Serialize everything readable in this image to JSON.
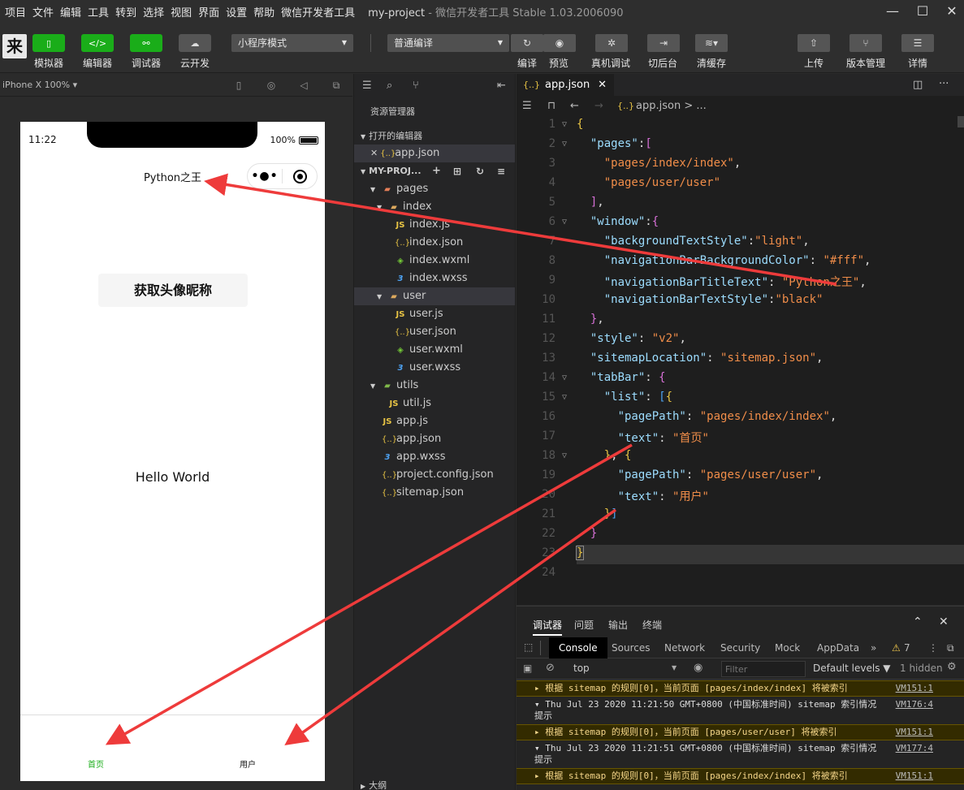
{
  "menu": {
    "items": [
      "项目",
      "文件",
      "编辑",
      "工具",
      "转到",
      "选择",
      "视图",
      "界面",
      "设置",
      "帮助",
      "微信开发者工具"
    ],
    "project_name": "my-project",
    "app_version": "- 微信开发者工具 Stable 1.03.2006090"
  },
  "toolbar": {
    "simulator": "模拟器",
    "editor": "编辑器",
    "debugger": "调试器",
    "cloud": "云开发",
    "mode_select": "小程序模式",
    "compile_select": "普通编译",
    "compile": "编译",
    "preview": "预览",
    "real_debug": "真机调试",
    "switch_bg": "切后台",
    "clear_cache": "清缓存",
    "upload": "上传",
    "version": "版本管理",
    "details": "详情"
  },
  "simulator": {
    "device": "iPhone X 100% ▾",
    "time": "11:22",
    "battery": "100%",
    "nav_title": "Python之王",
    "get_button": "获取头像昵称",
    "hello": "Hello World",
    "tab_home": "首页",
    "tab_user": "用户",
    "tab_active_color": "#1aad19"
  },
  "explorer": {
    "title": "资源管理器",
    "open_editors": "打开的编辑器",
    "open_file": "app.json",
    "project": "MY-PROJ...",
    "outline": "大纲",
    "files": [
      {
        "name": "pages",
        "icon": "folder-red"
      },
      {
        "name": "index",
        "icon": "folder"
      },
      {
        "name": "index.js",
        "icon": "js"
      },
      {
        "name": "index.json",
        "icon": "json"
      },
      {
        "name": "index.wxml",
        "icon": "wxml"
      },
      {
        "name": "index.wxss",
        "icon": "wxss"
      },
      {
        "name": "user",
        "icon": "folder"
      },
      {
        "name": "user.js",
        "icon": "js"
      },
      {
        "name": "user.json",
        "icon": "json"
      },
      {
        "name": "user.wxml",
        "icon": "wxml"
      },
      {
        "name": "user.wxss",
        "icon": "wxss"
      },
      {
        "name": "utils",
        "icon": "folder-green"
      },
      {
        "name": "util.js",
        "icon": "js"
      },
      {
        "name": "app.js",
        "icon": "js"
      },
      {
        "name": "app.json",
        "icon": "json"
      },
      {
        "name": "app.wxss",
        "icon": "wxss"
      },
      {
        "name": "project.config.json",
        "icon": "json"
      },
      {
        "name": "sitemap.json",
        "icon": "json"
      }
    ]
  },
  "editor": {
    "tab": "app.json",
    "breadcrumb": "app.json > ...",
    "line_numbers": [
      "1",
      "2",
      "3",
      "4",
      "5",
      "6",
      "7",
      "8",
      "9",
      "10",
      "11",
      "12",
      "13",
      "14",
      "15",
      "16",
      "17",
      "18",
      "19",
      "20",
      "21",
      "22",
      "23",
      "24"
    ]
  },
  "debug": {
    "tabs": [
      "调试器",
      "问题",
      "输出",
      "终端"
    ],
    "console_tabs": [
      "Console",
      "Sources",
      "Network",
      "Security",
      "Mock",
      "AppData"
    ],
    "warn_count": "7",
    "context": "top",
    "filter_placeholder": "Filter",
    "levels": "Default levels ▼",
    "hidden": "1 hidden",
    "logs": [
      {
        "type": "warn",
        "text": "▸ 根据 sitemap 的规则[0]，当前页面 [pages/index/index] 将被索引",
        "src": "VM151:1"
      },
      {
        "type": "info",
        "text": "▾ Thu Jul 23 2020 11:21:50 GMT+0800 (中国标准时间) sitemap 索引情况提示",
        "src": "VM176:4"
      },
      {
        "type": "warn",
        "text": "▸ 根据 sitemap 的规则[0]，当前页面 [pages/user/user] 将被索引",
        "src": "VM151:1"
      },
      {
        "type": "info",
        "text": "▾ Thu Jul 23 2020 11:21:51 GMT+0800 (中国标准时间) sitemap 索引情况提示",
        "src": "VM177:4"
      },
      {
        "type": "warn",
        "text": "▸ 根据 sitemap 的规则[0]，当前页面 [pages/index/index] 将被索引",
        "src": "VM151:1"
      }
    ]
  }
}
